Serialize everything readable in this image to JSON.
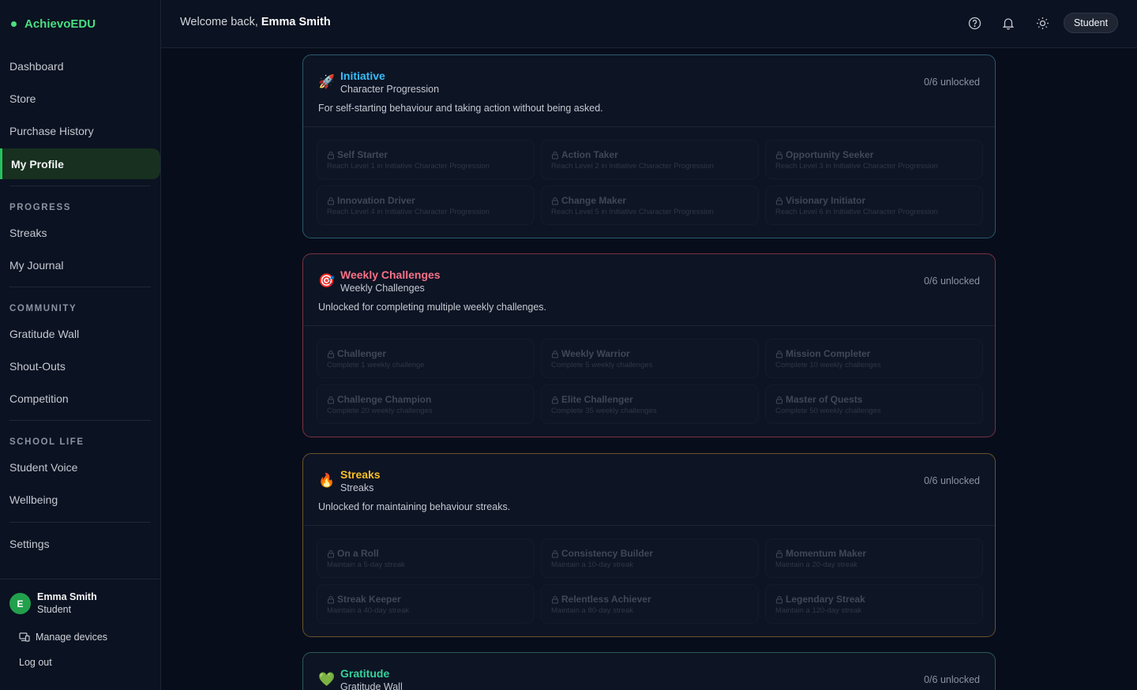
{
  "brand": "AchievoEDU",
  "header": {
    "welcome_prefix": "Welcome back, ",
    "user_name": "Emma Smith",
    "role": "Student"
  },
  "sidebar": {
    "items": [
      "Dashboard",
      "Store",
      "Purchase History",
      "My Profile"
    ],
    "active": "My Profile",
    "sections": [
      {
        "title": "PROGRESS",
        "items": [
          "Streaks",
          "My Journal"
        ]
      },
      {
        "title": "COMMUNITY",
        "items": [
          "Gratitude Wall",
          "Shout-Outs",
          "Competition"
        ]
      },
      {
        "title": "SCHOOL LIFE",
        "items": [
          "Student Voice",
          "Wellbeing"
        ]
      }
    ],
    "settings": "Settings",
    "user": {
      "initial": "E",
      "name": "Emma Smith",
      "role": "Student"
    },
    "manage_devices": "Manage devices",
    "logout": "Log out"
  },
  "cards": [
    {
      "emoji": "🚀",
      "title": "Initiative",
      "subtitle": "Character Progression",
      "count": "0/6 unlocked",
      "description": "For self-starting behaviour and taking action without being asked.",
      "badges": [
        {
          "title": "Self Starter",
          "desc": "Reach Level 1 in Initiative Character Progression"
        },
        {
          "title": "Action Taker",
          "desc": "Reach Level 2 in Initiative Character Progression"
        },
        {
          "title": "Opportunity Seeker",
          "desc": "Reach Level 3 in Initiative Character Progression"
        },
        {
          "title": "Innovation Driver",
          "desc": "Reach Level 4 in Initiative Character Progression"
        },
        {
          "title": "Change Maker",
          "desc": "Reach Level 5 in Initiative Character Progression"
        },
        {
          "title": "Visionary Initiator",
          "desc": "Reach Level 6 in Initiative Character Progression"
        }
      ]
    },
    {
      "emoji": "🎯",
      "title": "Weekly Challenges",
      "subtitle": "Weekly Challenges",
      "count": "0/6 unlocked",
      "description": "Unlocked for completing multiple weekly challenges.",
      "badges": [
        {
          "title": "Challenger",
          "desc": "Complete 1 weekly challenge"
        },
        {
          "title": "Weekly Warrior",
          "desc": "Complete 5 weekly challenges"
        },
        {
          "title": "Mission Completer",
          "desc": "Complete 10 weekly challenges"
        },
        {
          "title": "Challenge Champion",
          "desc": "Complete 20 weekly challenges"
        },
        {
          "title": "Elite Challenger",
          "desc": "Complete 35 weekly challenges"
        },
        {
          "title": "Master of Quests",
          "desc": "Complete 50 weekly challenges"
        }
      ]
    },
    {
      "emoji": "🔥",
      "title": "Streaks",
      "subtitle": "Streaks",
      "count": "0/6 unlocked",
      "description": "Unlocked for maintaining behaviour streaks.",
      "badges": [
        {
          "title": "On a Roll",
          "desc": "Maintain a 5-day streak"
        },
        {
          "title": "Consistency Builder",
          "desc": "Maintain a 10-day streak"
        },
        {
          "title": "Momentum Maker",
          "desc": "Maintain a 20-day streak"
        },
        {
          "title": "Streak Keeper",
          "desc": "Maintain a 40-day streak"
        },
        {
          "title": "Relentless Achiever",
          "desc": "Maintain a 80-day streak"
        },
        {
          "title": "Legendary Streak",
          "desc": "Maintain a 120-day streak"
        }
      ]
    },
    {
      "emoji": "💚",
      "title": "Gratitude",
      "subtitle": "Gratitude Wall",
      "count": "0/6 unlocked"
    }
  ],
  "colors": {
    "accent": "#4ade80",
    "background": "#070d1b",
    "initiative": "#38bdf8",
    "weekly": "#f87187",
    "streaks": "#fbbf24",
    "gratitude": "#34d399"
  }
}
